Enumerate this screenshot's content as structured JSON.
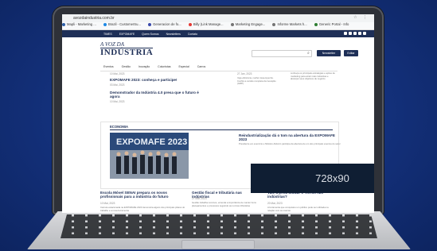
{
  "browser": {
    "url": "avozdaindustria.com.br",
    "bookmarks": [
      "Mapli - Marketing ...",
      "Brazil - CustomerSu...",
      "Generacion de fo...",
      "Billy (Link Manage...",
      "Marketing Engage...",
      "Informe Markets h...",
      "Generic Portal - Info"
    ]
  },
  "site": {
    "topnav": [
      "TIMES",
      "EXPOMAFE",
      "Quem Somos",
      "Newsletters",
      "Contato"
    ],
    "logo_line1": "A VOZ DA",
    "logo_line2": "INDÚSTRIA",
    "subscribe_label": "Newsletter",
    "extra_label": "Editar",
    "menu": [
      "Eventos",
      "Gestão",
      "Inovação",
      "Colunistas",
      "Especial",
      "Carros"
    ]
  },
  "articles_top": [
    {
      "date": "10 Mai, 2023"
    },
    {
      "title": "EXPOMAFE 2023: conheça e participe!",
      "date": "03 Mai, 2023"
    },
    {
      "title": "Demonstrador da Indústria 4.0 presa que o futuro é agora",
      "date": "10 Mai, 2023"
    }
  ],
  "mid_column": {
    "date": "27 Jan, 2023",
    "text": "Veja eficiência, melhor desempenho. Confira a versão completa da inovação (GRP)"
  },
  "right_column": {
    "text": "conheça os principais estratégias e ações de marketing para atrair mais indústrias e alcançar seus objetivos de negócio"
  },
  "section": {
    "label": "ECONOMIA",
    "feature_title": "Reindustrialização dá o tom na abertura da EXPOMAFE 2023",
    "feature_text": "Presidente em exercício e Ministro Alckmin participa da abertura de um dos principais eventos do setor"
  },
  "ad": {
    "label": "728x90"
  },
  "articles_bottom": [
    {
      "title": "Escola Móvel SENAI prepara os novos profissionais para a indústria do futuro",
      "date": "10 Mai, 2023",
      "text": "Carreta estacionada na EXPOMAFE 2023 demonstra alguns dos principais pilares do trabalho e a nova ferramenta"
    },
    {
      "title": "Gestão fiscal e tributária nas indústrias",
      "date": "27 Mar, 2023",
      "text": "Gestão trabalha recursos, entenda a importância de manter bons planejamentos e processos seguindo as normas tributárias"
    },
    {
      "title": "Vale a pena utilizar o TikTok nas indústrias?",
      "date": "20 Mar, 2023",
      "text": "A ferramenta que conquistou um público pode ser utilizada na relação com as marcas"
    }
  ],
  "colors": {
    "brand": "#1e2f57",
    "background": "#13307a"
  }
}
